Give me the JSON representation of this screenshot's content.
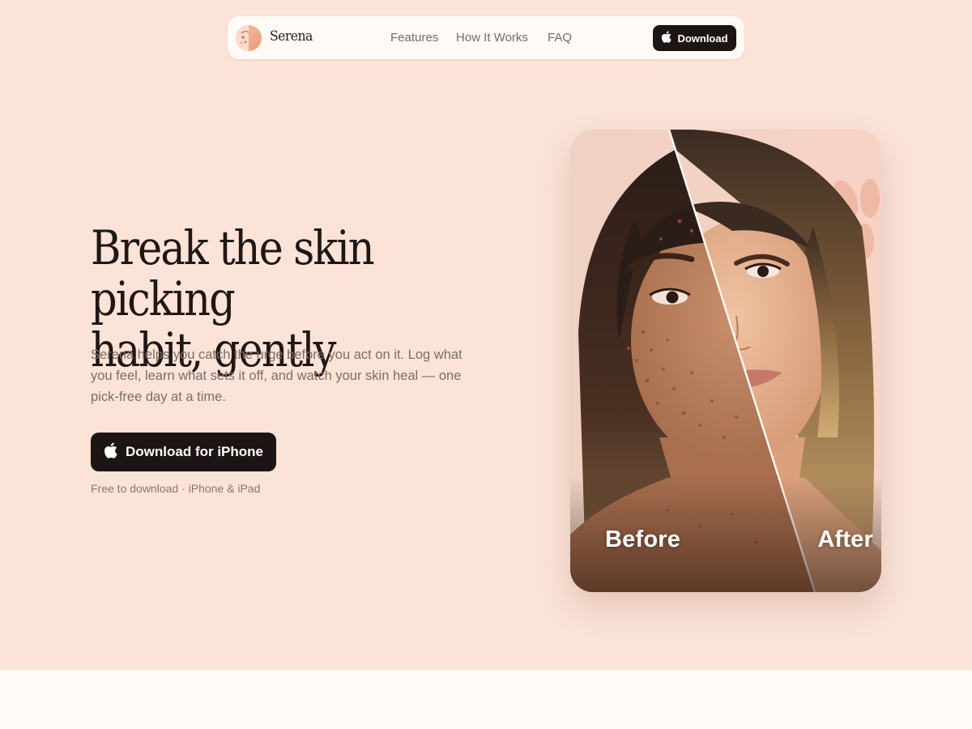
{
  "nav": {
    "brand": "Serena",
    "links": [
      "Features",
      "How It Works",
      "FAQ"
    ],
    "download_label": "Download"
  },
  "hero": {
    "headline_line1": "Break the skin picking",
    "headline_line2": "habit, gently",
    "lede": "Serena helps you catch the urge before you act on it. Log what you feel, learn what sets it off, and watch your skin heal — one pick-free day at a time.",
    "cta_label": "Download for iPhone",
    "cta_note": "Free to download · iPhone & iPad"
  },
  "photo": {
    "before_label": "Before",
    "after_label": "After"
  },
  "colors": {
    "page_bg": "#fbe3d8",
    "nav_bg": "#fffaf6",
    "button_bg": "#1d1513",
    "text_muted": "#7d6d66",
    "bottom_band": "#fffaf6"
  },
  "icons": [
    "apple-icon",
    "serena-logo-icon"
  ]
}
